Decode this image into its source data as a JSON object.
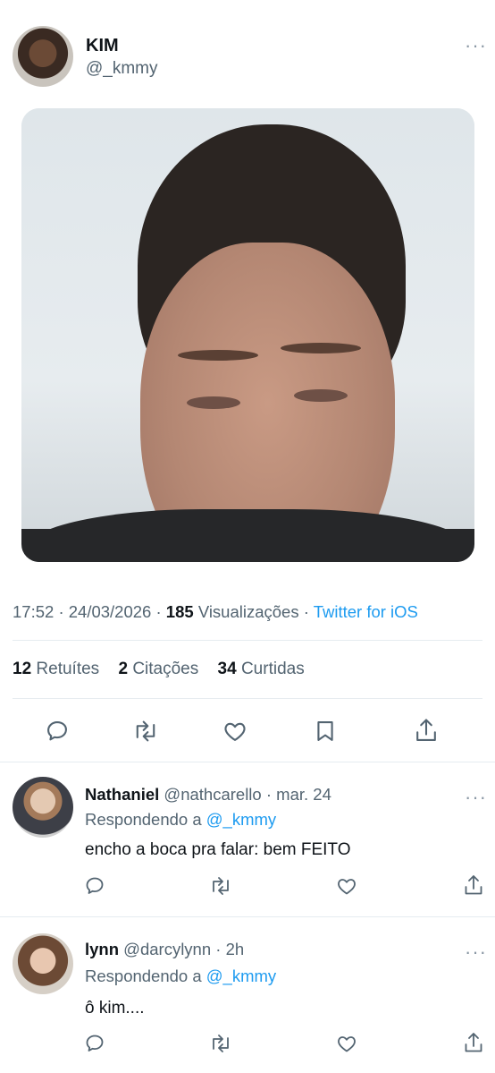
{
  "tweet": {
    "author_name": "KIM",
    "author_handle": "@_kmmy",
    "time": "17:52",
    "date": "24/03/2026",
    "views_count": "185",
    "views_label": "Visualizações",
    "source": "Twitter for iOS",
    "retweets_count": "12",
    "retweets_label": "Retuítes",
    "quotes_count": "2",
    "quotes_label": "Citações",
    "likes_count": "34",
    "likes_label": "Curtidas"
  },
  "replies": [
    {
      "name": "Nathaniel",
      "handle": "@nathcarello",
      "time": "mar. 24",
      "replying_prefix": "Respondendo a",
      "replying_to": "@_kmmy",
      "text": "encho a boca pra falar: bem FEITO"
    },
    {
      "name": "lynn",
      "handle": "@darcylynn",
      "time": "2h",
      "replying_prefix": "Respondendo a",
      "replying_to": "@_kmmy",
      "text": "ô kim...."
    }
  ],
  "colors": {
    "accent": "#1d9bf0",
    "secondary_text": "#536471",
    "primary_text": "#0f1419",
    "divider": "#e6ecf0"
  },
  "icons": [
    "reply-icon",
    "retweet-icon",
    "like-icon",
    "bookmark-icon",
    "share-icon",
    "more-icon"
  ]
}
